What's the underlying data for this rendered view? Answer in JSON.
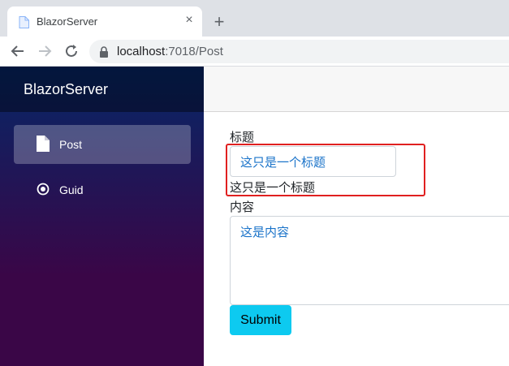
{
  "browser": {
    "tab_title": "BlazorServer",
    "tab_close": "×",
    "new_tab": "+",
    "url_host": "localhost",
    "url_path": ":7018/Post"
  },
  "sidebar": {
    "brand": "BlazorServer",
    "items": [
      {
        "label": "Post",
        "icon": "document-icon",
        "active": true
      },
      {
        "label": "Guid",
        "icon": "radio-circle-icon",
        "active": false
      }
    ]
  },
  "form": {
    "title_label": "标题",
    "title_value": "这只是一个标题",
    "title_echo": "这只是一个标题",
    "content_label": "内容",
    "content_value": "这是内容",
    "submit_label": "Submit"
  },
  "colors": {
    "submit_bg": "#0dcaf0",
    "highlight_border": "#e02020",
    "sidebar_top": "#052767",
    "sidebar_bottom": "#3a0647"
  }
}
